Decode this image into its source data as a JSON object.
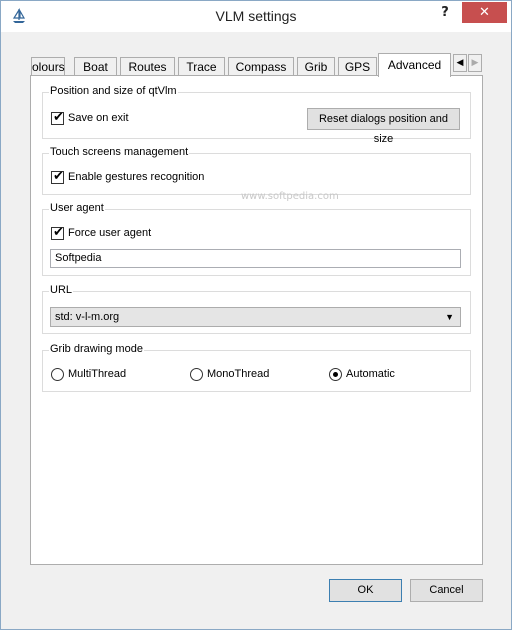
{
  "window": {
    "title": "VLM settings",
    "help_label": "?",
    "close_label": "✕"
  },
  "tabs": [
    {
      "label": "olours"
    },
    {
      "label": "Boat"
    },
    {
      "label": "Routes"
    },
    {
      "label": "Trace"
    },
    {
      "label": "Compass"
    },
    {
      "label": "Grib"
    },
    {
      "label": "GPS"
    },
    {
      "label": "Advanced",
      "active": true
    }
  ],
  "tab_scroll": {
    "left": "◀",
    "right": "▶"
  },
  "position_group": {
    "title": "Position and size of qtVlm",
    "save_on_exit": {
      "label": "Save on exit",
      "checked": true
    },
    "reset_button": "Reset dialogs position and size"
  },
  "touch_group": {
    "title": "Touch screens management",
    "gestures": {
      "label": "Enable gestures recognition",
      "checked": true
    }
  },
  "user_agent_group": {
    "title": "User agent",
    "force": {
      "label": "Force user agent",
      "checked": true
    },
    "value": "Softpedia"
  },
  "url_group": {
    "title": "URL",
    "selected": "std: v-l-m.org"
  },
  "grib_group": {
    "title": "Grib drawing mode",
    "options": [
      {
        "label": "MultiThread",
        "selected": false
      },
      {
        "label": "MonoThread",
        "selected": false
      },
      {
        "label": "Automatic",
        "selected": true
      }
    ]
  },
  "watermark": "www.softpedia.com",
  "buttons": {
    "ok": "OK",
    "cancel": "Cancel"
  }
}
